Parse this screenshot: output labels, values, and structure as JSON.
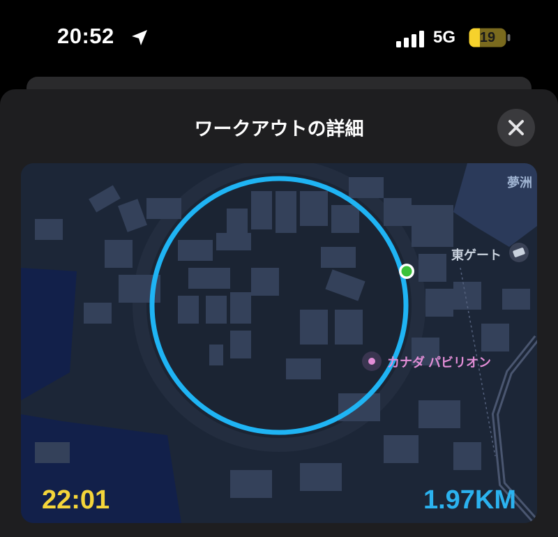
{
  "status_bar": {
    "time": "20:52",
    "network": "5G",
    "battery": "19",
    "location_icon": "location-arrow-icon",
    "signal_icon": "cellular-signal-icon"
  },
  "sheet": {
    "title": "ワークアウトの詳細",
    "close_icon": "close-icon"
  },
  "map": {
    "labels": {
      "yumeshima": "夢洲",
      "east_gate": "東ゲート",
      "canada_pavilion": "カナダ パビリオン"
    },
    "route_color": "#1fb4f4",
    "start_marker_color": "#3ac23a"
  },
  "workout": {
    "duration": "22:01",
    "distance": "1.97KM"
  },
  "colors": {
    "duration": "#f4d53a",
    "distance": "#2bb2ef",
    "background": "#000000",
    "sheet": "#1e1e20"
  }
}
